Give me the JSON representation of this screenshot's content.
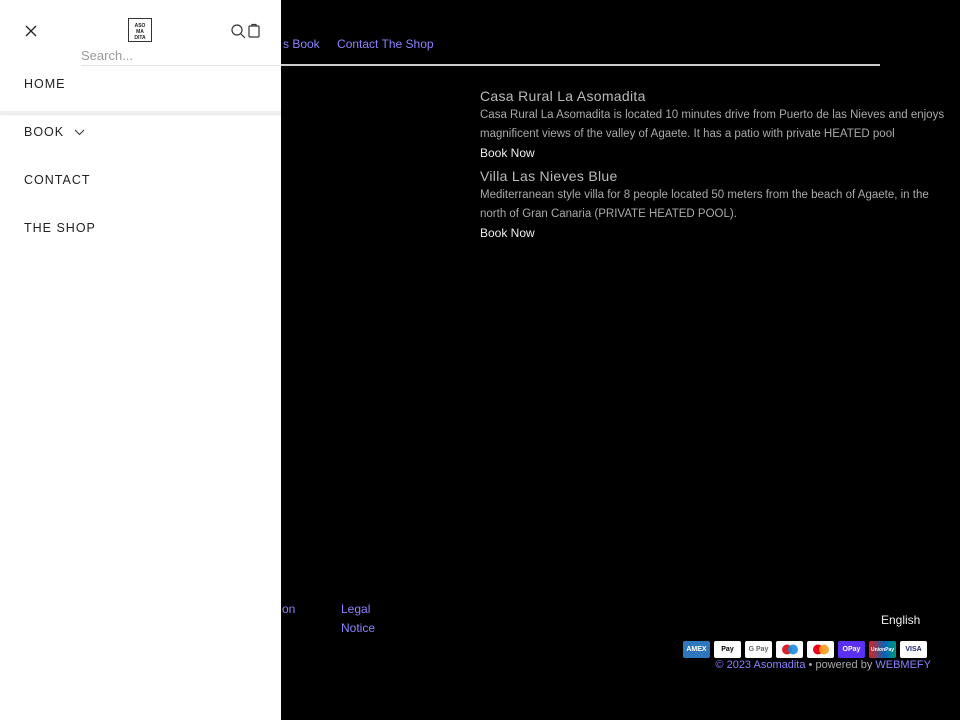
{
  "header": {
    "nav_fragment": "s Book",
    "contact_shop": "Contact The Shop"
  },
  "properties": [
    {
      "title": "Casa Rural La Asomadita",
      "description": "Casa Rural La Asomadita is located 10 minutes drive from Puerto de las Nieves and enjoys magnificent views of the valley of Agaete. It has a patio with private HEATED pool",
      "cta": "Book Now"
    },
    {
      "title": "Villa Las Nieves Blue",
      "description": "Mediterranean style villa for 8 people located 50 meters from the beach of Agaete, in the north of Gran Canaria (PRIVATE HEATED POOL).",
      "cta": "Book Now"
    }
  ],
  "footer": {
    "link_fragment": "on",
    "legal_1": "Legal",
    "legal_2": "Notice",
    "language": "English",
    "payments": [
      "AMEX",
      "Pay",
      "G Pay",
      "maestro",
      "mastercard",
      "OPay",
      "UnionPay",
      "VISA"
    ],
    "copyright": "© 2023 Asomadita",
    "powered": " • powered by ",
    "brand": "WEBMEFY"
  },
  "drawer": {
    "logo": [
      "ASO",
      "MA",
      "DITA"
    ],
    "search_placeholder": "Search...",
    "items": [
      {
        "label": "HOME"
      },
      {
        "label": "BOOK"
      },
      {
        "label": "CONTACT"
      },
      {
        "label": "THE SHOP"
      }
    ]
  },
  "colors": {
    "accent": "#8c82ff",
    "background": "#000000",
    "drawer": "#ffffff"
  }
}
